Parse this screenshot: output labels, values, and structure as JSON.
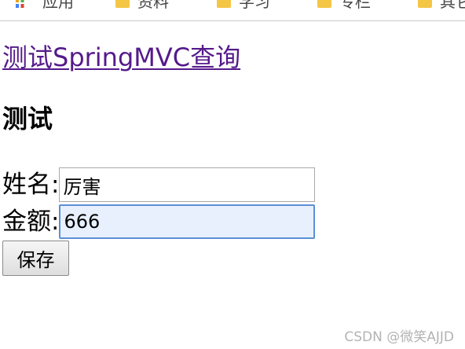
{
  "bookmarks": {
    "items": [
      {
        "icon": "apps-icon",
        "label": "应用"
      },
      {
        "icon": "folder-icon",
        "label": "资料"
      },
      {
        "icon": "folder-icon",
        "label": "学习"
      },
      {
        "icon": "folder-icon",
        "label": "专栏"
      },
      {
        "icon": "folder-icon",
        "label": "其它"
      }
    ],
    "folder_color": "#f4c646"
  },
  "page": {
    "link_text": "测试SpringMVC查询",
    "heading": "测试"
  },
  "form": {
    "name_label": "姓名:",
    "name_value": "厉害",
    "amount_label": "金额:",
    "amount_value": "666",
    "save_label": "保存",
    "focused_field": "amount",
    "focus_color": "#5b8fd6"
  },
  "watermark": "CSDN @微笑AJJD"
}
